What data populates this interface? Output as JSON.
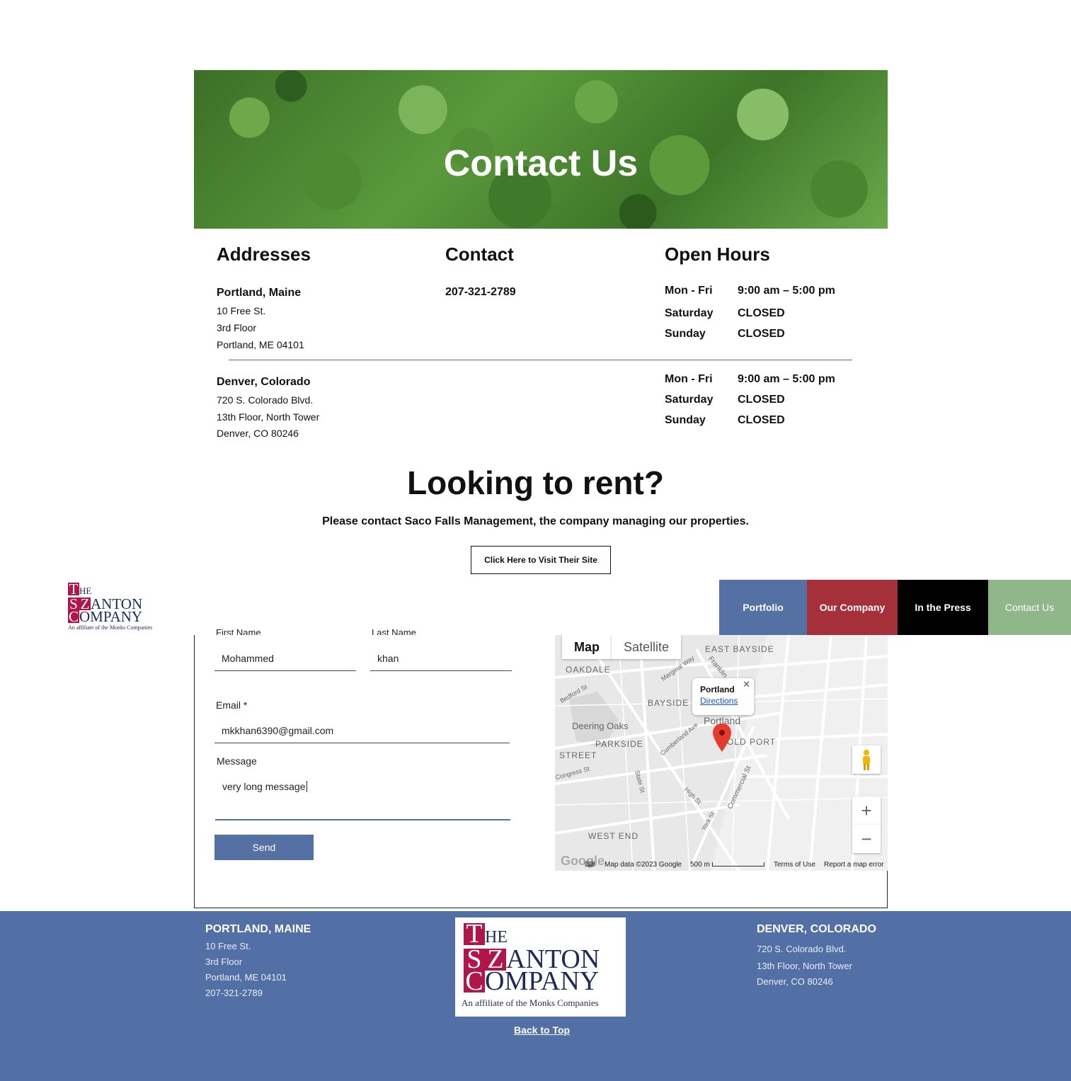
{
  "hero": {
    "title": "Contact Us"
  },
  "addresses": {
    "heading": "Addresses",
    "portland": {
      "city": "Portland, Maine",
      "line1": "10 Free St.",
      "line2": "3rd Floor",
      "line3": "Portland, ME 04101"
    },
    "denver": {
      "city": "Denver, Colorado",
      "line1": "720 S. Colorado Blvd.",
      "line2": "13th Floor, North Tower",
      "line3": "Denver, CO 80246"
    }
  },
  "contact": {
    "heading": "Contact",
    "phone": "207-321-2789"
  },
  "hours": {
    "heading": "Open Hours",
    "portland": [
      {
        "day": "Mon - Fri",
        "time": "9:00 am – 5:00 pm"
      },
      {
        "day": "Saturday",
        "time": "CLOSED"
      },
      {
        "day": "Sunday",
        "time": "CLOSED"
      }
    ],
    "denver": [
      {
        "day": "Mon - Fri",
        "time": "9:00 am – 5:00 pm"
      },
      {
        "day": "Saturday",
        "time": "CLOSED"
      },
      {
        "day": "Sunday",
        "time": "CLOSED"
      }
    ]
  },
  "rent": {
    "title": "Looking to rent?",
    "subtitle": "Please contact Saco Falls Management, the company managing our properties.",
    "button": "Click Here to Visit Their Site"
  },
  "logo": {
    "the": "HE",
    "t": "T",
    "s": "S",
    "z": "Z",
    "anton": "ANTON",
    "c": "C",
    "ompany": "OMPANY",
    "tagline": "An affiliate of the Monks Companies"
  },
  "nav": {
    "items": [
      "Portfolio",
      "Our Company",
      "In the Press",
      "Contact Us"
    ],
    "colors": [
      "#5570a3",
      "#a5303a",
      "#000000",
      "#8fb78a"
    ]
  },
  "form": {
    "first_name_label": "First Name",
    "last_name_label": "Last Name",
    "first_name_value": "Mohammed",
    "last_name_value": "khan",
    "email_label": "Email *",
    "email_value": "mkkhan6390@gmail.com",
    "message_label": "Message",
    "message_value": "very long message",
    "send": "Send"
  },
  "map": {
    "tab_map": "Map",
    "tab_satellite": "Satellite",
    "popup_title": "Portland",
    "popup_link": "Directions",
    "labels": [
      "EAST BAYSIDE",
      "OAKDALE",
      "BAYSIDE",
      "Deering Oaks",
      "PARKSIDE",
      "STREET",
      "OLD PORT",
      "WEST END",
      "Portland"
    ],
    "streets": [
      "Bedford St",
      "Marginal Way",
      "Franklin",
      "Cumberland Ave",
      "State St",
      "High St",
      "York St",
      "Commercial St",
      "Congress St"
    ],
    "footer": {
      "data": "Map data ©2023 Google",
      "scale": "500 m",
      "terms": "Terms of Use",
      "report": "Report a map error",
      "brand": "Google"
    }
  },
  "footer": {
    "portland": {
      "heading": "PORTLAND, MAINE",
      "line1": "10 Free St.",
      "line2": "3rd Floor",
      "line3": "Portland, ME 04101",
      "phone": "207-321-2789"
    },
    "denver": {
      "heading": "DENVER, COLORADO",
      "line1": "720 S. Colorado Blvd.",
      "line2": "13th Floor, North Tower",
      "line3": "Denver, CO 80246"
    },
    "back_to_top": "Back to Top"
  }
}
